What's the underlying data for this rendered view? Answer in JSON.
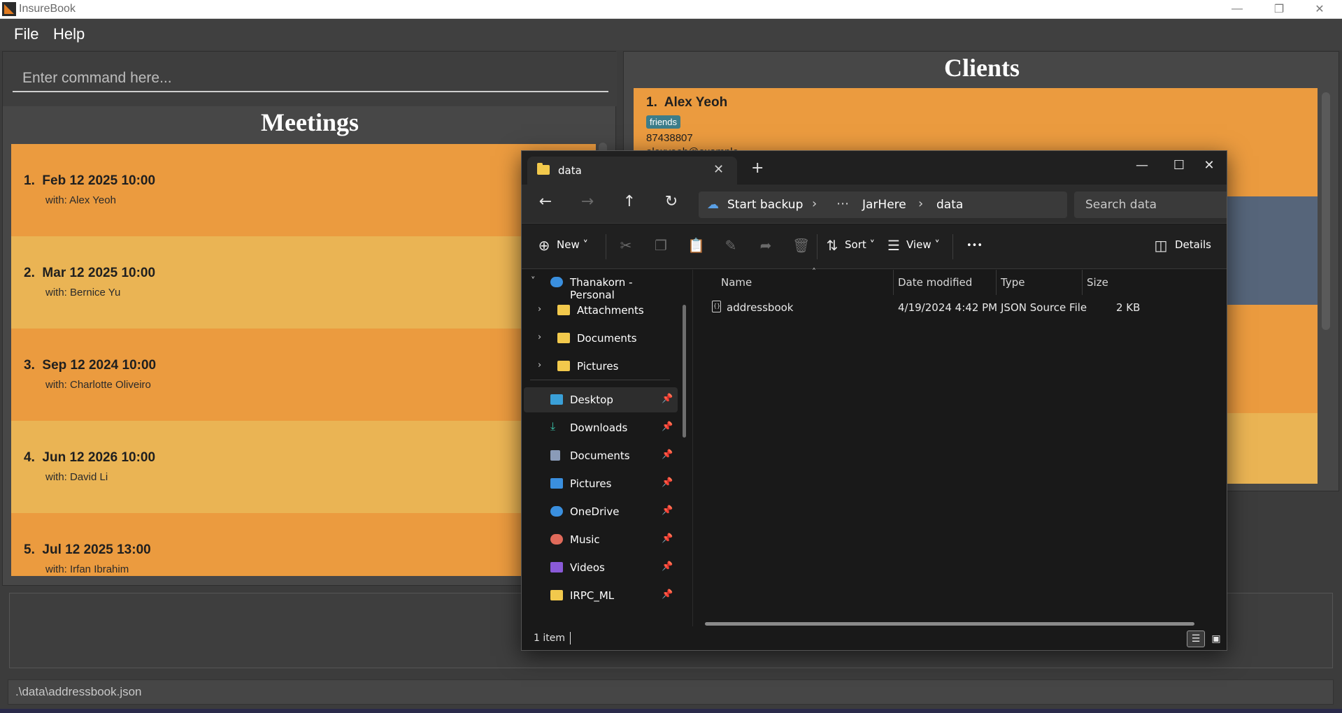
{
  "app": {
    "title": "InsureBook",
    "menu": [
      "File",
      "Help"
    ],
    "command_placeholder": "Enter command here...",
    "meetings_title": "Meetings",
    "clients_title": "Clients",
    "status_path": ".\\data\\addressbook.json"
  },
  "meetings": [
    {
      "index": "1.",
      "datetime": "Feb 12 2025 10:00",
      "with": "with: Alex Yeoh"
    },
    {
      "index": "2.",
      "datetime": "Mar 12 2025 10:00",
      "with": "with: Bernice Yu"
    },
    {
      "index": "3.",
      "datetime": "Sep 12 2024 10:00",
      "with": "with: Charlotte Oliveiro"
    },
    {
      "index": "4.",
      "datetime": "Jun 12 2026 10:00",
      "with": "with: David Li"
    },
    {
      "index": "5.",
      "datetime": "Jul 12 2025 13:00",
      "with": "with: Irfan Ibrahim"
    }
  ],
  "clients": [
    {
      "index": "1.",
      "name": "Alex Yeoh",
      "tag": "friends",
      "phone": "87438807",
      "email_partial": "alexyeoh@example"
    }
  ],
  "explorer": {
    "tab_label": "data",
    "address": {
      "backup": "Start backup",
      "dots": "⋯",
      "folder1": "JarHere",
      "folder2": "data"
    },
    "search_placeholder": "Search data",
    "toolbar": {
      "new": "New",
      "sort": "Sort",
      "view": "View",
      "more": "•••",
      "details": "Details"
    },
    "sidebar": {
      "account": "Thanakorn - Personal",
      "folders": [
        "Attachments",
        "Documents",
        "Pictures"
      ],
      "quick": [
        "Desktop",
        "Downloads",
        "Documents",
        "Pictures",
        "OneDrive",
        "Music",
        "Videos",
        "IRPC_ML"
      ]
    },
    "columns": {
      "name": "Name",
      "date": "Date modified",
      "type": "Type",
      "size": "Size"
    },
    "files": [
      {
        "name": "addressbook",
        "date": "4/19/2024 4:42 PM",
        "type": "JSON Source File",
        "size": "2 KB"
      }
    ],
    "status": "1 item"
  },
  "colors": {
    "meeting_odd": "#eb9b3f",
    "meeting_even": "#eab454",
    "client_selected": "#56657a",
    "tag": "#3d7d8a"
  },
  "icons": [
    "app-logo-icon",
    "minimize-icon",
    "restore-icon",
    "close-icon",
    "folder-icon",
    "plus-icon",
    "back-arrow-icon",
    "forward-arrow-icon",
    "up-arrow-icon",
    "refresh-icon",
    "cloud-icon",
    "chevron-right-icon",
    "search-icon",
    "cut-icon",
    "copy-icon",
    "paste-icon",
    "rename-icon",
    "share-icon",
    "delete-icon",
    "sort-icon",
    "view-icon",
    "details-icon",
    "pin-icon",
    "json-file-icon"
  ]
}
